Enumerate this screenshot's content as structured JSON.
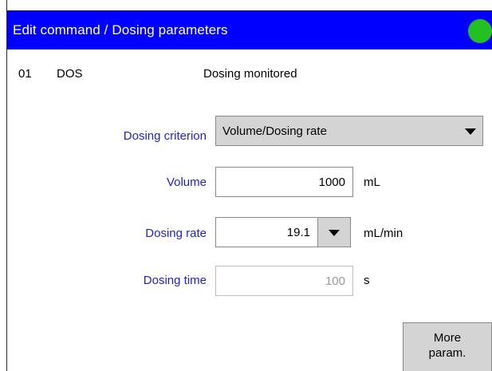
{
  "window": {
    "title": "Edit command / Dosing parameters",
    "status_color": "#22c020"
  },
  "command": {
    "number": "01",
    "name": "DOS",
    "description": "Dosing monitored"
  },
  "form": {
    "criterion": {
      "label": "Dosing criterion",
      "value": "Volume/Dosing rate"
    },
    "volume": {
      "label": "Volume",
      "value": "1000",
      "unit": "mL"
    },
    "rate": {
      "label": "Dosing rate",
      "value": "19.1",
      "unit": "mL/min"
    },
    "time": {
      "label": "Dosing time",
      "value": "100",
      "unit": "s"
    }
  },
  "buttons": {
    "more_line1": "More",
    "more_line2": "param."
  },
  "colors": {
    "title_bar": "#0000ff",
    "label_text": "#2222cc",
    "button_face": "#d4d4d4"
  }
}
